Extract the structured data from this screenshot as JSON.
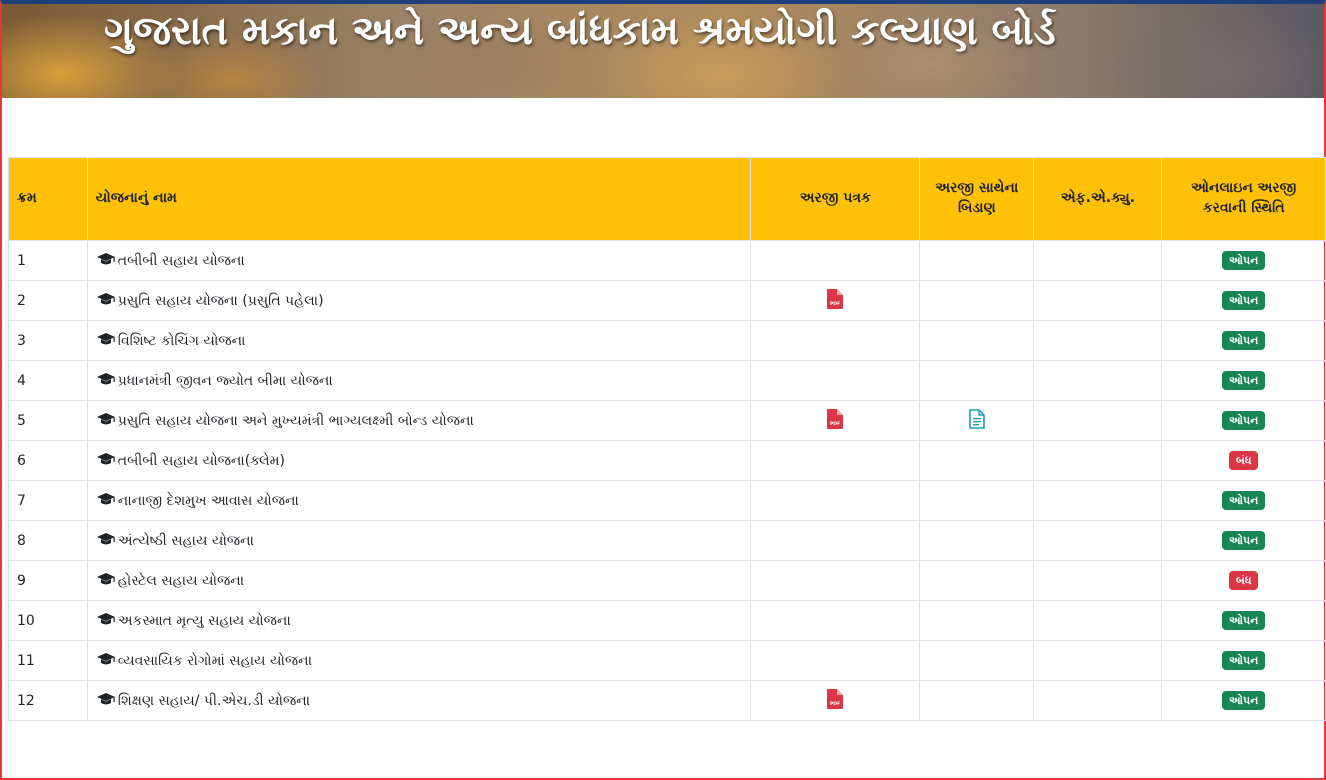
{
  "header": {
    "title": "ગુજરાત મકાન અને અન્ય બાંધકામ શ્રમયોગી કલ્યાણ બોર્ડ"
  },
  "table": {
    "headers": {
      "num": "ક્રમ",
      "name": "યોજનાનું નામ",
      "form": "અરજી પત્રક",
      "docs": "અરજી સાથેના બિડાણ",
      "faq": "એફ.એ.ક્યુ.",
      "status": "ઓનલાઇન અરજી કરવાની સ્થિતિ"
    },
    "rows": [
      {
        "num": "1",
        "name": "તબીબી સહાય યોજના",
        "pdf": false,
        "doc": false,
        "status": "ઓપન",
        "open": true
      },
      {
        "num": "2",
        "name": "પ્રસુતિ સહાય યોજના (પ્રસુતિ પહેલા)",
        "pdf": true,
        "doc": false,
        "status": "ઓપન",
        "open": true
      },
      {
        "num": "3",
        "name": "વિશિષ્ટ કોચિંગ યોજના",
        "pdf": false,
        "doc": false,
        "status": "ઓપન",
        "open": true
      },
      {
        "num": "4",
        "name": "પ્રધાનમંત્રી જીવન જ્યોત બીમા યોજના",
        "pdf": false,
        "doc": false,
        "status": "ઓપન",
        "open": true
      },
      {
        "num": "5",
        "name": "પ્રસુતિ સહાય યોજના અને મુખ્યમંત્રી ભાગ્યલક્ષ્મી બોન્ડ યોજના",
        "pdf": true,
        "doc": true,
        "status": "ઓપન",
        "open": true
      },
      {
        "num": "6",
        "name": "તબીબી સહાય યોજના(ક્લેમ)",
        "pdf": false,
        "doc": false,
        "status": "બંધ",
        "open": false
      },
      {
        "num": "7",
        "name": "નાનાજી દેશમુખ આવાસ યોજના",
        "pdf": false,
        "doc": false,
        "status": "ઓપન",
        "open": true
      },
      {
        "num": "8",
        "name": "અંત્યેષ્ઠી સહાય યોજના",
        "pdf": false,
        "doc": false,
        "status": "ઓપન",
        "open": true
      },
      {
        "num": "9",
        "name": "હોસ્ટેલ સહાય યોજના",
        "pdf": false,
        "doc": false,
        "status": "બંધ",
        "open": false
      },
      {
        "num": "10",
        "name": "અકસ્માત મૃત્યુ સહાય યોજના",
        "pdf": false,
        "doc": false,
        "status": "ઓપન",
        "open": true
      },
      {
        "num": "11",
        "name": "વ્યવસાયિક રોગોમાં સહાય યોજના",
        "pdf": false,
        "doc": false,
        "status": "ઓપન",
        "open": true
      },
      {
        "num": "12",
        "name": "શિક્ષણ સહાય/ પી.એચ.ડી યોજના",
        "pdf": true,
        "doc": false,
        "status": "ઓપન",
        "open": true
      }
    ]
  },
  "icons": {
    "scheme": "graduation-cap-icon",
    "form": "pdf-file-icon",
    "docs": "document-icon"
  },
  "colors": {
    "header_bg": "#ffc107",
    "open": "#198754",
    "closed": "#dc3545",
    "pdf": "#dc3545",
    "doc": "#17a2b8"
  }
}
